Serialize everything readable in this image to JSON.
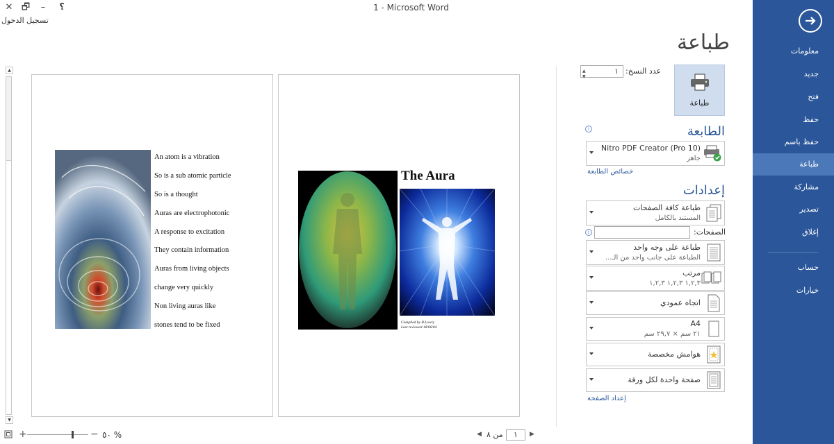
{
  "window": {
    "title": "1 - Microsoft Word",
    "help": "؟",
    "minimize": "–",
    "restore": "🗗",
    "close": "✕",
    "sign_in": "تسجيل الدخول"
  },
  "nav": {
    "items": [
      "معلومات",
      "جديد",
      "فتح",
      "حفظ",
      "حفظ باسم",
      "طباعة",
      "مشاركة",
      "تصدير",
      "إغلاق"
    ],
    "active_index": 5,
    "bottom_items": [
      "حساب",
      "خيارات"
    ]
  },
  "page_title": "طباعة",
  "print": {
    "button_label": "طباعة",
    "copies_label": "عدد النسخ:",
    "copies_value": "١"
  },
  "printer": {
    "heading": "الطابعة",
    "name": "Nitro PDF Creator (Pro 10)",
    "status": "جاهز",
    "properties_link": "خصائص الطابعة"
  },
  "settings": {
    "heading": "إعدادات",
    "pages_label": "الصفحات:",
    "pages_value": "",
    "range": {
      "line1": "طباعة كافة الصفحات",
      "line2": "المستند بالكامل"
    },
    "sides": {
      "line1": "طباعة على وجه واحد",
      "line2": "الطباعة على جانب واحد من الـ..."
    },
    "collate": {
      "line1": "مرتب",
      "line2": "١,٢,٣   ١,٢,٣   ١,٢,٣"
    },
    "orientation": {
      "line1": "اتجاه عمودي"
    },
    "paper": {
      "line1": "A4",
      "line2": "٢١ سم × ٢٩,٧ سم"
    },
    "margins": {
      "line1": "هوامش مخصصة"
    },
    "per_sheet": {
      "line1": "صفحة واحدة لكل ورقة"
    },
    "page_setup_link": "إعداد الصفحة"
  },
  "preview": {
    "left_page_lines": [
      "An atom is a vibration",
      "So is a sub atomic particle",
      "So is a thought",
      "Auras are electrophotonic",
      "A response to excitation",
      "They contain information",
      "Auras from living objects",
      "change very quickly",
      "Non living auras like",
      "stones tend to be fixed"
    ],
    "right_page_title": "The Aura",
    "credit_lines": [
      "Compiled by B.Lowry",
      "Last reviewed 18/06/04"
    ]
  },
  "footer": {
    "current_page": "١",
    "of_pages": "من ٨",
    "zoom": "٥٠ %",
    "zoom_level": 0.5
  },
  "colors": {
    "nav_bg": "#2b579a",
    "nav_active": "#4b78b8",
    "accent_text": "#2b579a",
    "print_button_bg": "#cfddee"
  }
}
